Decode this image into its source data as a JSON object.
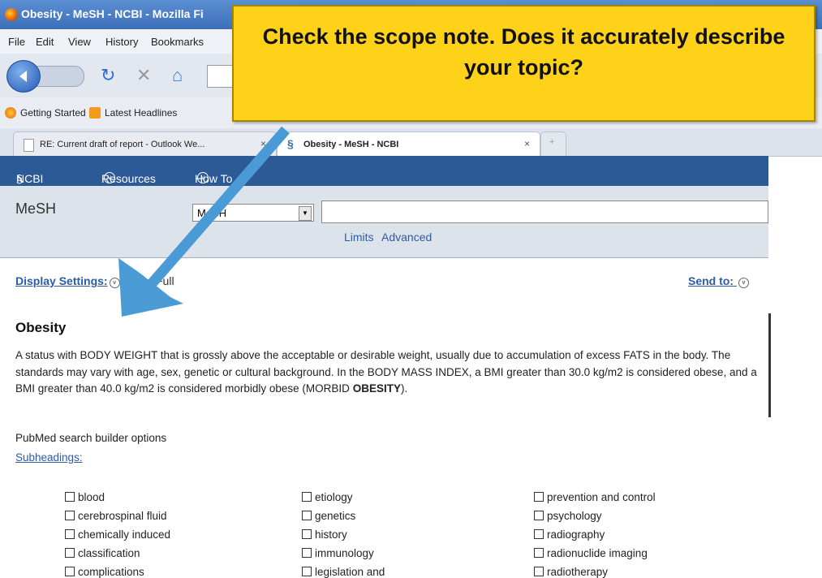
{
  "window": {
    "title": "Obesity - MeSH - NCBI - Mozilla Fi"
  },
  "menubar": {
    "items": [
      "File",
      "Edit",
      "View",
      "History",
      "Bookmarks"
    ]
  },
  "bookmarks": {
    "items": [
      "Getting Started",
      "Latest Headlines"
    ]
  },
  "tabs": [
    {
      "label": "RE: Current draft of report - Outlook We...",
      "close": "×"
    },
    {
      "label": "Obesity - MeSH - NCBI",
      "close": "×"
    },
    {
      "label": "+"
    }
  ],
  "ncbi_bar": {
    "logo": "NCBI",
    "resources": "Resources",
    "howto": "How To"
  },
  "search": {
    "db_label": "MeSH",
    "db_select": "MeSH",
    "limits": "Limits",
    "advanced": "Advanced"
  },
  "display": {
    "settings_label": "Display Settings:",
    "value": "Full",
    "send_to": "Send to:"
  },
  "record": {
    "title": "Obesity",
    "scope_note_pre": "A status with BODY WEIGHT that is grossly above the acceptable or desirable weight, usually due to accumulation of excess FATS in the body. The standards may vary with age, sex, genetic or cultural background. In the BODY MASS INDEX, a BMI greater than 30.0 kg/m2 is considered obese, and a BMI greater than 40.0 kg/m2 is considered morbidly obese (MORBID ",
    "scope_note_bold": "OBESITY",
    "scope_note_post": ")."
  },
  "builder": {
    "label": "PubMed search builder options",
    "subheadings_link": "Subheadings:",
    "col1": [
      "blood",
      "cerebrospinal fluid",
      "chemically induced",
      "classification",
      "complications"
    ],
    "col2": [
      "etiology",
      "genetics",
      "history",
      "immunology",
      "legislation and"
    ],
    "col3": [
      "prevention and control",
      "psychology",
      "radiography",
      "radionuclide imaging",
      "radiotherapy"
    ]
  },
  "callout": {
    "text": "Check the scope note. Does it accurately describe your topic?"
  },
  "colors": {
    "callout_bg": "#ffd21a",
    "arrow": "#4a9ad6",
    "ncbi_bar": "#2c5a97",
    "link": "#2b5ca8"
  }
}
